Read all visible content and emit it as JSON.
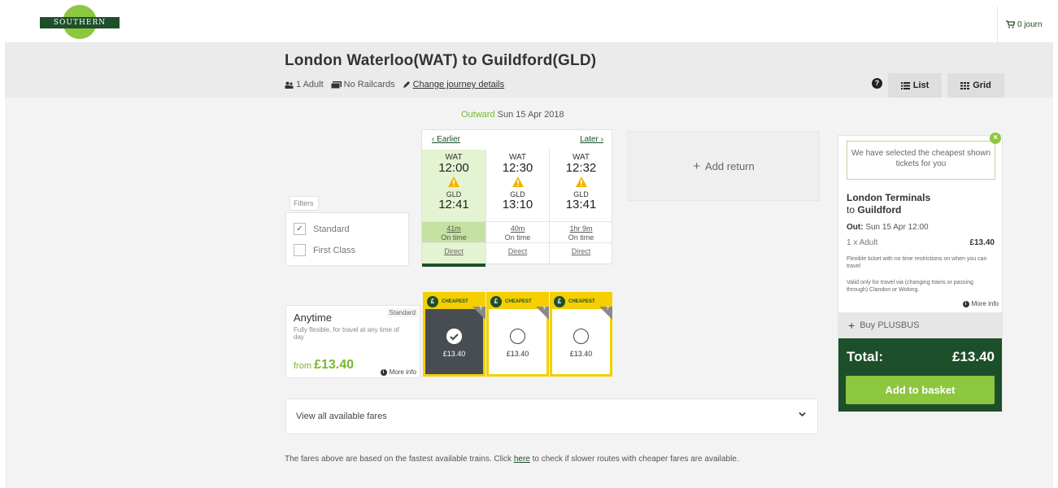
{
  "brand": {
    "logo_text": "SOUTHERN"
  },
  "basket": {
    "label": "0 journ"
  },
  "journey": {
    "title": "London Waterloo(WAT) to Guildford(GLD)",
    "passengers": "1 Adult",
    "railcards": "No Railcards",
    "change_link": "Change journey details"
  },
  "view": {
    "list_label": "List",
    "grid_label": "Grid"
  },
  "outward": {
    "label": "Outward",
    "date": "Sun 15 Apr 2018"
  },
  "filters": {
    "label": "Filters",
    "options": [
      {
        "label": "Standard",
        "checked": true
      },
      {
        "label": "First Class",
        "checked": false
      }
    ]
  },
  "trains_nav": {
    "earlier": "Earlier",
    "later": "Later"
  },
  "trains": [
    {
      "from": "WAT",
      "depart": "12:00",
      "to": "GLD",
      "arrive": "12:41",
      "duration": "41m",
      "status": "On time",
      "type": "Direct",
      "selected": true
    },
    {
      "from": "WAT",
      "depart": "12:30",
      "to": "GLD",
      "arrive": "13:10",
      "duration": "40m",
      "status": "On time",
      "type": "Direct",
      "selected": false
    },
    {
      "from": "WAT",
      "depart": "12:32",
      "to": "GLD",
      "arrive": "13:41",
      "duration": "1hr 9m",
      "status": "On time",
      "type": "Direct",
      "selected": false
    }
  ],
  "add_return": {
    "label": "Add return"
  },
  "fare": {
    "name": "Anytime",
    "class": "Standard",
    "description": "Fully flexible, for travel at any time of day",
    "from_label": "from",
    "from_price": "£13.40",
    "more_info": "More info"
  },
  "fare_cells": [
    {
      "badge": "CHEAPEST",
      "price": "£13.40",
      "selected": true
    },
    {
      "badge": "CHEAPEST",
      "price": "£13.40",
      "selected": false
    },
    {
      "badge": "CHEAPEST",
      "price": "£13.40",
      "selected": false
    }
  ],
  "view_all": {
    "label": "View all available fares"
  },
  "footnote": {
    "before": "The fares above are based on the fastest available trains. Click ",
    "link": "here",
    "after": " to check if slower routes with cheaper fares are available."
  },
  "summary": {
    "tooltip": "We have selected the cheapest shown tickets for you",
    "from": "London Terminals",
    "to_prefix": "to",
    "to": "Guildford",
    "out_label": "Out:",
    "out_value": "Sun 15 Apr 12:00",
    "passenger": "1 x Adult",
    "passenger_price": "£13.40",
    "note1": "Flexible ticket with no time restrictions on when you can travel",
    "note2": "Valid only for travel via (changing trains or passing through) Clandon or Woking.",
    "more_info": "More info",
    "plusbus": "Buy PLUSBUS",
    "total_label": "Total:",
    "total_value": "£13.40",
    "add_to_basket": "Add to basket"
  },
  "colors": {
    "brand_dark": "#1d4f2a",
    "brand_green": "#8dc63f",
    "accent_yellow": "#f5cf00"
  }
}
